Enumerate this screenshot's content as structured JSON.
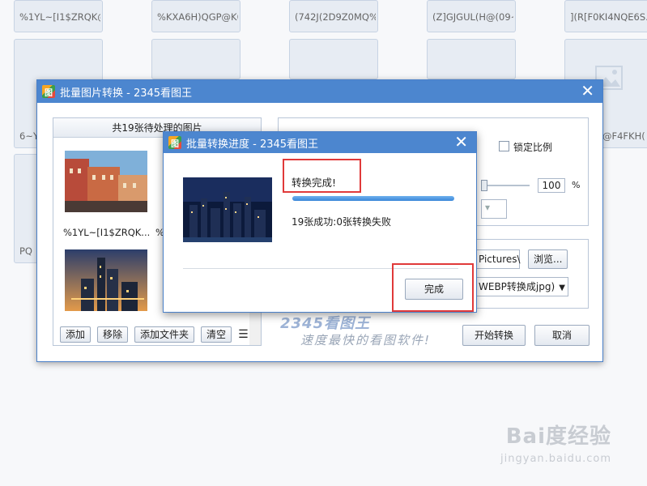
{
  "background": {
    "thumbnails": [
      {
        "label": "%1YL~[I1$ZRQK@IK..."
      },
      {
        "label": "%KXA6H)QGP@K0K..."
      },
      {
        "label": "(742J(2D9Z0MQ%5C..."
      },
      {
        "label": "(Z]GJGUL(H@(09~26..."
      },
      {
        "label": "](R[F0KI4NQE6S..."
      }
    ],
    "side_labels": {
      "left1": "6~Y",
      "left2": "PQ",
      "right1": "@F4FKH("
    }
  },
  "main_dialog": {
    "title": "批量图片转换 - 2345看图王",
    "close_label": "✕",
    "list_header": "共19张待处理的图片",
    "captions": [
      "%1YL~[I1$ZRQK...",
      "%"
    ],
    "buttons": {
      "add": "添加",
      "remove": "移除",
      "add_folder": "添加文件夹",
      "clear": "清空",
      "menu": "☰",
      "start": "开始转换",
      "cancel": "取消",
      "browse": "浏览..."
    },
    "lock_ratio_label": "锁定比例",
    "quality_value": "100",
    "quality_unit": "%",
    "path_value": "Pictures\\",
    "format_value": "WEBP转换成jpg)",
    "logo_text": "2345看图王",
    "slogan": "速度最快的看图软件!"
  },
  "progress_dialog": {
    "title": "批量转换进度 - 2345看图王",
    "close_label": "✕",
    "status": "转换完成!",
    "progress": 1.0,
    "summary": "19张成功:0张转换失败",
    "done_button": "完成"
  },
  "watermark": {
    "main": "Bai度经验",
    "sub": "jingyan.baidu.com"
  },
  "colors": {
    "title_bar": "#4c86cf",
    "highlight": "#e03a3a",
    "progress": "#3a86d8"
  }
}
